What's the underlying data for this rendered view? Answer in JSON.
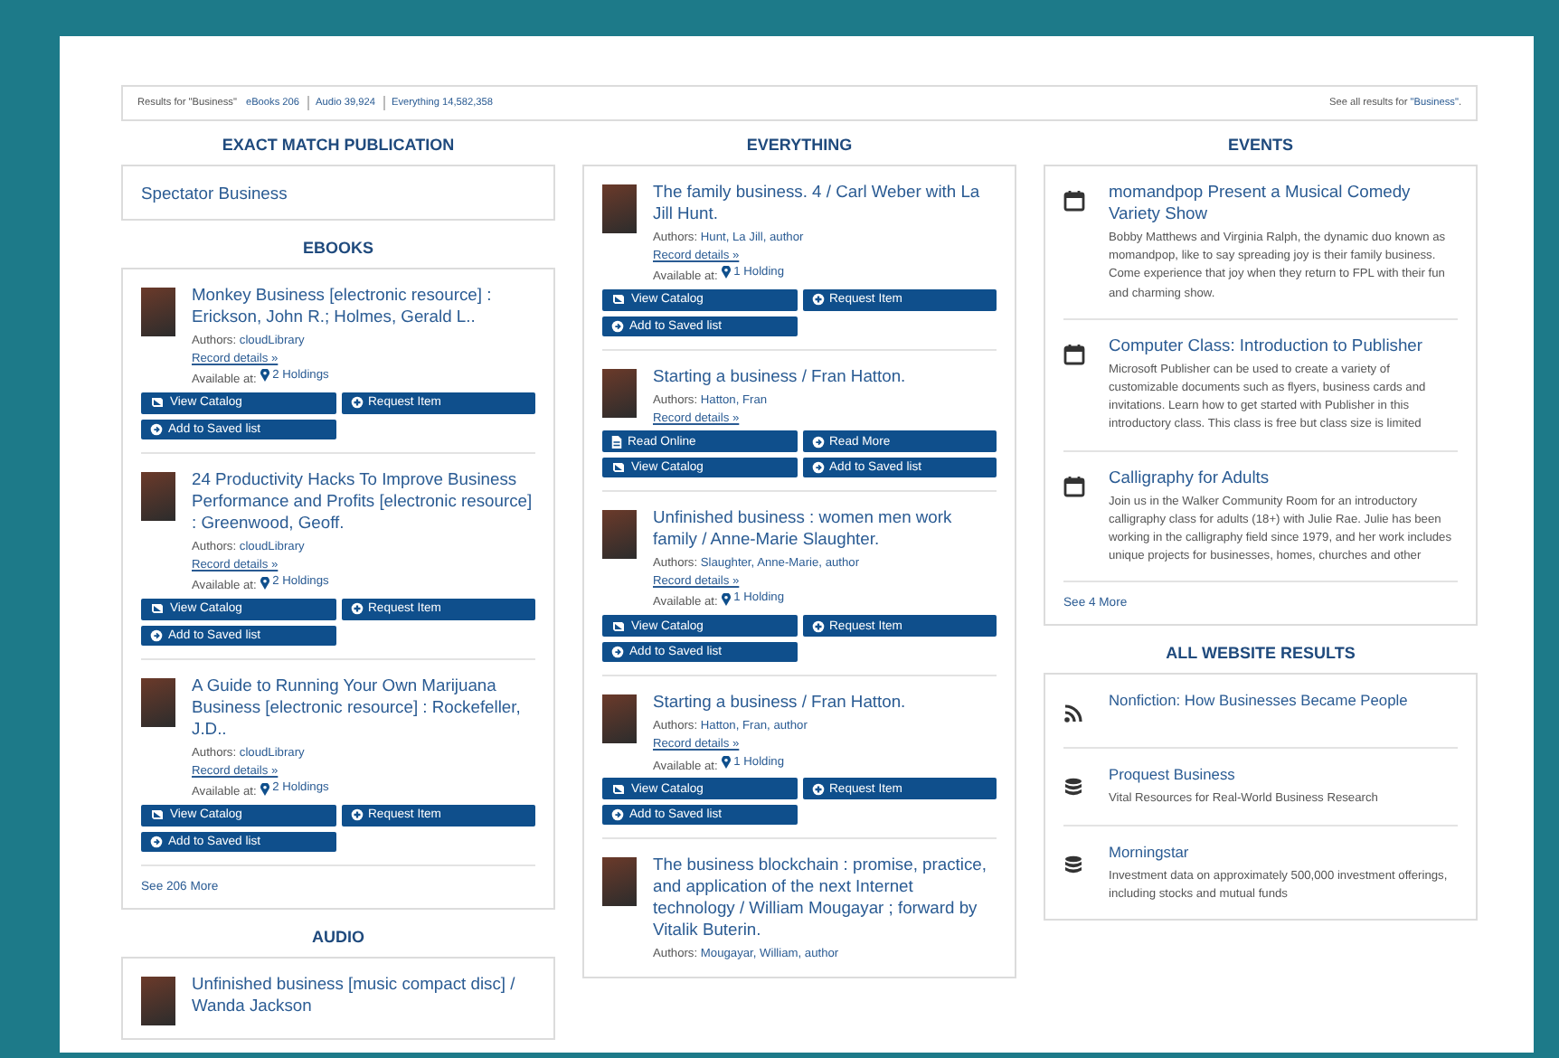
{
  "results_bar": {
    "label": "Results for \"Business\"",
    "links": [
      {
        "label": "eBooks 206"
      },
      {
        "label": "Audio 39,924"
      },
      {
        "label": "Everything 14,582,358"
      }
    ],
    "see_all": {
      "prefix": "See all results for ",
      "link": "\"Business\"",
      "suffix": "."
    }
  },
  "columns": [
    {
      "sections": [
        {
          "kind": "publication",
          "heading": "EXACT MATCH PUBLICATION",
          "items": [
            {
              "title": "Spectator Business"
            }
          ]
        },
        {
          "kind": "catalog",
          "heading": "EBOOKS",
          "items": [
            {
              "title": "Monkey Business [electronic resource] : Erickson, John R.; Holmes, Gerald L..",
              "authors_label": "Authors:",
              "authors": "cloudLibrary",
              "record_details": "Record details »",
              "available_label": "Available at:",
              "holdings": "2 Holdings",
              "buttons": [
                {
                  "kind": "catalog",
                  "label": "View Catalog"
                },
                {
                  "kind": "request",
                  "label": "Request Item"
                },
                {
                  "kind": "saved",
                  "label": "Add to Saved list"
                }
              ]
            },
            {
              "title": "24 Productivity Hacks To Improve Business Performance and Profits [electronic resource] : Greenwood, Geoff.",
              "authors_label": "Authors:",
              "authors": "cloudLibrary",
              "record_details": "Record details »",
              "available_label": "Available at:",
              "holdings": "2 Holdings",
              "buttons": [
                {
                  "kind": "catalog",
                  "label": "View Catalog"
                },
                {
                  "kind": "request",
                  "label": "Request Item"
                },
                {
                  "kind": "saved",
                  "label": "Add to Saved list"
                }
              ]
            },
            {
              "title": "A Guide to Running Your Own Marijuana Business [electronic resource] : Rockefeller, J.D..",
              "authors_label": "Authors:",
              "authors": "cloudLibrary",
              "record_details": "Record details »",
              "available_label": "Available at:",
              "holdings": "2 Holdings",
              "buttons": [
                {
                  "kind": "catalog",
                  "label": "View Catalog"
                },
                {
                  "kind": "request",
                  "label": "Request Item"
                },
                {
                  "kind": "saved",
                  "label": "Add to Saved list"
                }
              ]
            }
          ],
          "see_more": "See 206 More"
        },
        {
          "kind": "catalog",
          "heading": "AUDIO",
          "items": [
            {
              "title": "Unfinished business [music compact disc] / Wanda Jackson"
            }
          ]
        }
      ]
    },
    {
      "sections": [
        {
          "kind": "catalog",
          "heading": "EVERYTHING",
          "items": [
            {
              "title": "The family business. 4 / Carl Weber with La Jill Hunt.",
              "authors_label": "Authors:",
              "authors": "Hunt, La Jill, author",
              "record_details": "Record details »",
              "available_label": "Available at:",
              "holdings": "1 Holding",
              "buttons": [
                {
                  "kind": "catalog",
                  "label": "View Catalog"
                },
                {
                  "kind": "request",
                  "label": "Request Item"
                },
                {
                  "kind": "saved",
                  "label": "Add to Saved list"
                }
              ]
            },
            {
              "title": "Starting a business / Fran Hatton.",
              "authors_label": "Authors:",
              "authors": "Hatton, Fran",
              "record_details": "Record details »",
              "buttons": [
                {
                  "kind": "read-online",
                  "label": "Read Online"
                },
                {
                  "kind": "read-more",
                  "label": "Read More"
                },
                {
                  "kind": "catalog",
                  "label": "View Catalog"
                },
                {
                  "kind": "saved",
                  "label": "Add to Saved list"
                }
              ]
            },
            {
              "title": "Unfinished business : women men work family / Anne-Marie Slaughter.",
              "authors_label": "Authors:",
              "authors": "Slaughter, Anne-Marie, author",
              "record_details": "Record details »",
              "available_label": "Available at:",
              "holdings": "1 Holding",
              "buttons": [
                {
                  "kind": "catalog",
                  "label": "View Catalog"
                },
                {
                  "kind": "request",
                  "label": "Request Item"
                },
                {
                  "kind": "saved",
                  "label": "Add to Saved list"
                }
              ]
            },
            {
              "title": "Starting a business / Fran Hatton.",
              "authors_label": "Authors:",
              "authors": "Hatton, Fran, author",
              "record_details": "Record details »",
              "available_label": "Available at:",
              "holdings": "1 Holding",
              "buttons": [
                {
                  "kind": "catalog",
                  "label": "View Catalog"
                },
                {
                  "kind": "request",
                  "label": "Request Item"
                },
                {
                  "kind": "saved",
                  "label": "Add to Saved list"
                }
              ]
            },
            {
              "title": "The business blockchain : promise, practice, and application of the next Internet technology / William Mougayar ; forward by Vitalik Buterin.",
              "authors_label": "Authors:",
              "authors": "Mougayar, William, author"
            }
          ]
        }
      ]
    },
    {
      "sections": [
        {
          "kind": "events",
          "heading": "EVENTS",
          "items": [
            {
              "kind": "calendar",
              "title": "momandpop Present a Musical Comedy Variety Show",
              "description": "Bobby Matthews and Virginia Ralph, the dynamic duo known as momandpop, like to say spreading joy is their family business. Come experience that joy when they return to FPL with their fun and charming show."
            },
            {
              "kind": "calendar",
              "title": "Computer Class: Introduction to Publisher",
              "description": "Microsoft Publisher can be used to create a variety of customizable documents such as flyers, business cards and invitations.  Learn how to get started with Publisher in this introductory class. This class is free but class size is limited"
            },
            {
              "kind": "calendar",
              "title": "Calligraphy for Adults",
              "description": "Join us in the Walker Community Room for an introductory calligraphy class for adults (18+) with Julie Rae. Julie has been working in the calligraphy field since 1979, and her work includes unique projects for businesses, homes, churches and other"
            }
          ],
          "see_more": "See 4 More"
        },
        {
          "kind": "website",
          "heading": "ALL WEBSITE RESULTS",
          "items": [
            {
              "kind": "rss",
              "title": "Nonfiction: How Businesses Became People"
            },
            {
              "kind": "database",
              "title": "Proquest Business",
              "description": "Vital Resources for Real-World Business Research"
            },
            {
              "kind": "database",
              "title": "Morningstar",
              "description": "Investment data on approximately 500,000 investment offerings, including stocks and mutual funds"
            }
          ]
        }
      ]
    }
  ]
}
